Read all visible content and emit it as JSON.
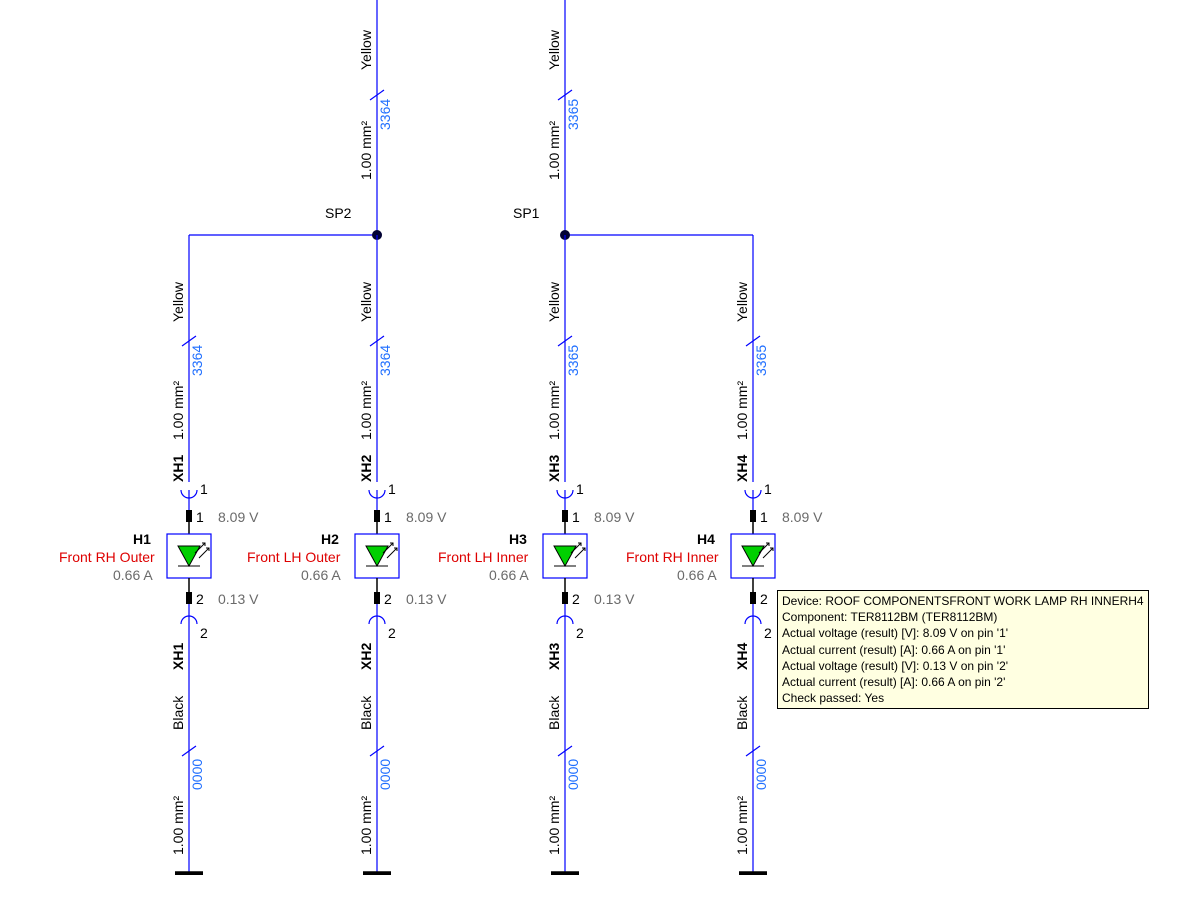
{
  "splices": {
    "sp2": "SP2",
    "sp1": "SP1"
  },
  "top_wires": {
    "left": {
      "color": "Yellow",
      "gauge": "1.00 mm²",
      "id": "3364"
    },
    "right": {
      "color": "Yellow",
      "gauge": "1.00 mm²",
      "id": "3365"
    }
  },
  "branches": [
    {
      "conn_top": "XH1",
      "conn_top_pin": "1",
      "wire_top": {
        "color": "Yellow",
        "gauge": "1.00 mm²",
        "id": "3364"
      },
      "device_id": "H1",
      "device_desc": "Front RH Outer",
      "pin1": "1",
      "pin1_v": "8.09 V",
      "pin2": "2",
      "pin2_v": "0.13 V",
      "current": "0.66 A",
      "conn_bot": "XH1",
      "conn_bot_pin": "2",
      "wire_bot": {
        "color": "Black",
        "gauge": "1.00 mm²",
        "id": "0000"
      }
    },
    {
      "conn_top": "XH2",
      "conn_top_pin": "1",
      "wire_top": {
        "color": "Yellow",
        "gauge": "1.00 mm²",
        "id": "3364"
      },
      "device_id": "H2",
      "device_desc": "Front LH Outer",
      "pin1": "1",
      "pin1_v": "8.09 V",
      "pin2": "2",
      "pin2_v": "0.13 V",
      "current": "0.66 A",
      "conn_bot": "XH2",
      "conn_bot_pin": "2",
      "wire_bot": {
        "color": "Black",
        "gauge": "1.00 mm²",
        "id": "0000"
      }
    },
    {
      "conn_top": "XH3",
      "conn_top_pin": "1",
      "wire_top": {
        "color": "Yellow",
        "gauge": "1.00 mm²",
        "id": "3365"
      },
      "device_id": "H3",
      "device_desc": "Front LH Inner",
      "pin1": "1",
      "pin1_v": "8.09 V",
      "pin2": "2",
      "pin2_v": "0.13 V",
      "current": "0.66 A",
      "conn_bot": "XH3",
      "conn_bot_pin": "2",
      "wire_bot": {
        "color": "Black",
        "gauge": "1.00 mm²",
        "id": "0000"
      }
    },
    {
      "conn_top": "XH4",
      "conn_top_pin": "1",
      "wire_top": {
        "color": "Yellow",
        "gauge": "1.00 mm²",
        "id": "3365"
      },
      "device_id": "H4",
      "device_desc": "Front RH Inner",
      "pin1": "1",
      "pin1_v": "8.09 V",
      "pin2": "2",
      "pin2_v": "0.13 V",
      "current": "0.66 A",
      "conn_bot": "XH4",
      "conn_bot_pin": "2",
      "wire_bot": {
        "color": "Black",
        "gauge": "1.00 mm²",
        "id": "0000"
      }
    }
  ],
  "tooltip": {
    "l1": "Device: ROOF COMPONENTSFRONT WORK LAMP RH INNERH4",
    "l2": "Component: TER8112BM (TER8112BM)",
    "l3": "Actual voltage (result) [V]: 8.09 V on pin '1'",
    "l4": "Actual current (result) [A]: 0.66 A on pin '1'",
    "l5": "Actual voltage (result) [V]: 0.13 V on pin '2'",
    "l6": "Actual current (result) [A]: 0.66 A on pin '2'",
    "l7": "Check passed: Yes"
  }
}
